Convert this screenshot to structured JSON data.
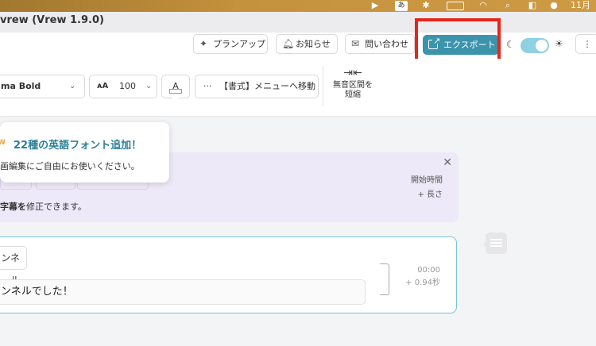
{
  "menubar": {
    "ime_label": "あ",
    "clock_partial": "11月"
  },
  "window": {
    "title": "vrew (Vrew 1.9.0)"
  },
  "top_toolbar": {
    "plan_up": "プランアップ",
    "notice": "お知らせ",
    "contact": "問い合わせ",
    "export": "エクスポート",
    "theme_toggle_on": true
  },
  "format_toolbar": {
    "font_name": "ma Bold",
    "font_size": "100",
    "text_color_label": "A",
    "menu_move": "【書式】メニューへ移動",
    "shorten_silence": "無音区間を短縮"
  },
  "popup": {
    "badge": "W",
    "title": "22種の英語フォント追加！",
    "body": "画編集にご自由にお使いください。"
  },
  "hint": {
    "time_label": "開始時間",
    "length_label": "+ 長さ",
    "text_bold": "字幕を",
    "text_rest": "修正できます。"
  },
  "clip": {
    "speaker": "ンネル",
    "subtitle": "ンネルでした！",
    "start": "00:00",
    "length": "+  0.94秒"
  },
  "icons": [
    "apple-menu-icon",
    "bluetooth-icon",
    "battery-icon",
    "wifi-icon",
    "search-icon",
    "control-center-icon",
    "siri-icon",
    "sparkle-icon",
    "bell-icon",
    "mail-icon",
    "export-icon",
    "moon-icon",
    "sun-icon",
    "more-icon",
    "chevron-down-icon",
    "shorten-silence-icon",
    "close-icon",
    "chat-icon"
  ],
  "colors": {
    "accent": "#3b93ac",
    "highlight_box": "#e5261b",
    "hint_background": "#ede9f8",
    "popup_title": "#2b7f9a"
  }
}
